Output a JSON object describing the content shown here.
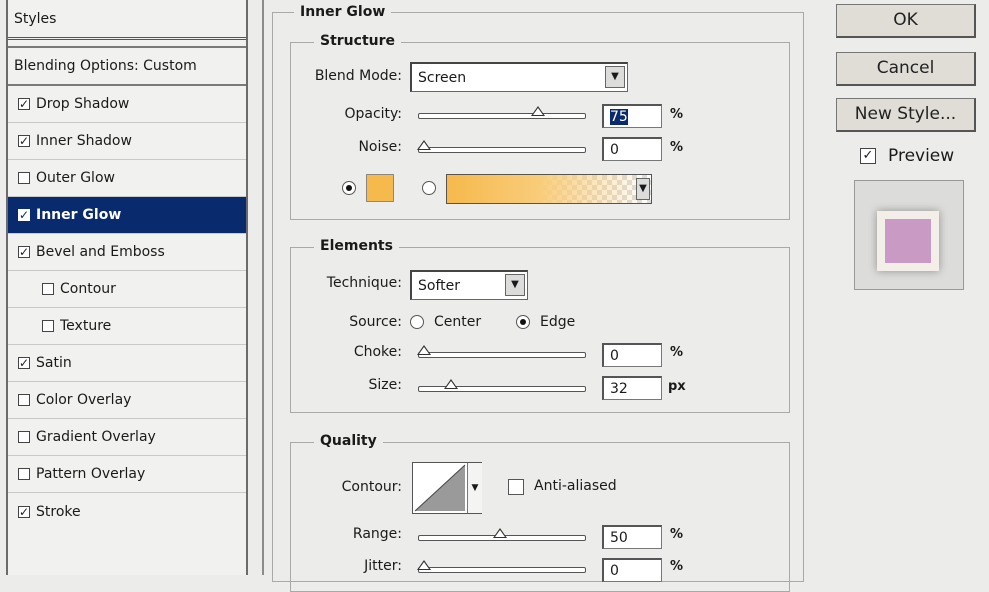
{
  "styles_panel": {
    "header": "Styles",
    "blending_options": "Blending Options: Custom",
    "items": [
      {
        "label": "Drop Shadow",
        "checked": true
      },
      {
        "label": "Inner Shadow",
        "checked": true
      },
      {
        "label": "Outer Glow",
        "checked": false
      },
      {
        "label": "Inner Glow",
        "checked": true
      },
      {
        "label": "Bevel and Emboss",
        "checked": true
      },
      {
        "label": "Contour",
        "checked": false
      },
      {
        "label": "Texture",
        "checked": false
      },
      {
        "label": "Satin",
        "checked": true
      },
      {
        "label": "Color Overlay",
        "checked": false
      },
      {
        "label": "Gradient Overlay",
        "checked": false
      },
      {
        "label": "Pattern Overlay",
        "checked": false
      },
      {
        "label": "Stroke",
        "checked": true
      }
    ],
    "selected": "Inner Glow"
  },
  "inner_glow": {
    "title": "Inner Glow",
    "structure": {
      "title": "Structure",
      "blend_mode_label": "Blend Mode:",
      "blend_mode_value": "Screen",
      "opacity_label": "Opacity:",
      "opacity_value": "75",
      "opacity_fraction": 0.75,
      "opacity_unit": "%",
      "noise_label": "Noise:",
      "noise_value": "0",
      "noise_fraction": 0,
      "noise_unit": "%",
      "color_mode": "solid",
      "glow_color": "#f6b94c"
    },
    "elements": {
      "title": "Elements",
      "technique_label": "Technique:",
      "technique_value": "Softer",
      "source_label": "Source:",
      "source_center": "Center",
      "source_edge": "Edge",
      "source_selected": "Edge",
      "choke_label": "Choke:",
      "choke_value": "0",
      "choke_fraction": 0,
      "choke_unit": "%",
      "size_label": "Size:",
      "size_value": "32",
      "size_fraction": 0.18,
      "size_unit": "px"
    },
    "quality": {
      "title": "Quality",
      "contour_label": "Contour:",
      "anti_aliased_label": "Anti-aliased",
      "anti_aliased_checked": false,
      "range_label": "Range:",
      "range_value": "50",
      "range_fraction": 0.5,
      "range_unit": "%",
      "jitter_label": "Jitter:",
      "jitter_value": "0",
      "jitter_fraction": 0,
      "jitter_unit": "%"
    }
  },
  "buttons": {
    "ok": "OK",
    "cancel": "Cancel",
    "new_style": "New Style...",
    "preview_label": "Preview",
    "preview_checked": true
  },
  "colors": {
    "selection": "#0a2a6e",
    "glow": "#f6b94c",
    "preview_swatch": "#c89ac4"
  }
}
